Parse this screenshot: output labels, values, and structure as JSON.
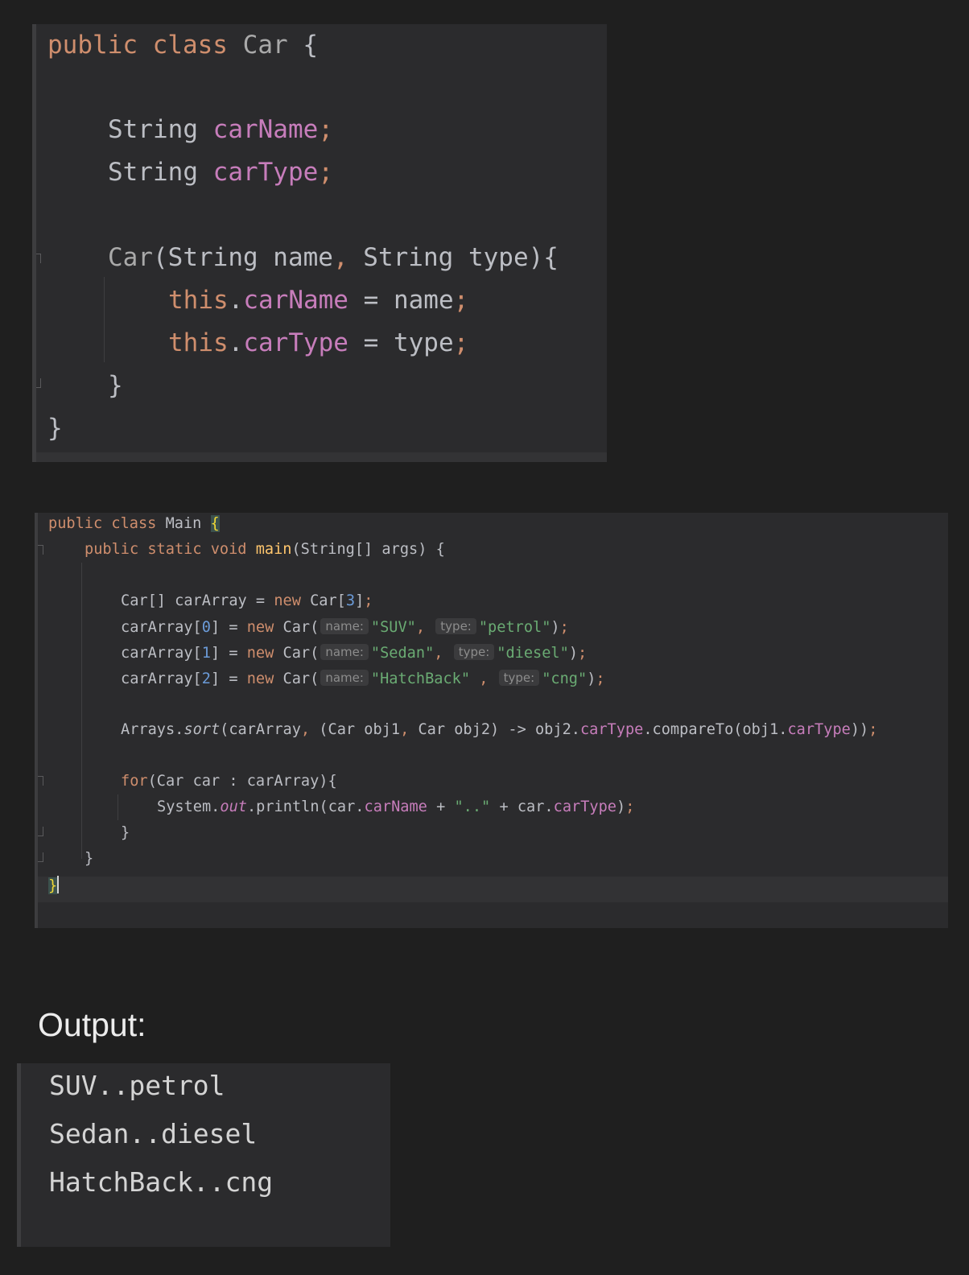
{
  "car_class_code": {
    "l1_public": "public",
    "l1_class": "class",
    "l1_name": "Car",
    "l1_brace": "{",
    "l3_type": "String",
    "l3_field": "carName",
    "l3_semi": ";",
    "l4_type": "String",
    "l4_field": "carType",
    "l4_semi": ";",
    "l6_ctor": "Car",
    "l6_p1": "(String name",
    "l6_comma": ",",
    "l6_p2": " String type){",
    "l7_this": "this",
    "l7_dot": ".",
    "l7_field": "carName",
    "l7_rest": " = name",
    "l7_semi": ";",
    "l8_this": "this",
    "l8_dot": ".",
    "l8_field": "carType",
    "l8_rest": " = type",
    "l8_semi": ";",
    "l9_close": "}",
    "l10_close": "}"
  },
  "main_class_code": {
    "l1_public": "public",
    "l1_class": "class",
    "l1_name": "Main",
    "l1_brace": "{",
    "l2_kw": "public static void",
    "l2_fn": "main",
    "l2_rest": "(String[] args) {",
    "l4_a": "Car[] carArray = ",
    "l4_new": "new",
    "l4_b": " Car[",
    "l4_num": "3",
    "l4_c": "]",
    "l4_semi": ";",
    "r1_a": "carArray[",
    "r1_idx": "0",
    "r1_b": "] = ",
    "r1_new": "new",
    "r1_c": " Car(",
    "r1_hint1": "name:",
    "r1_s1": "\"SUV\"",
    "r1_comma": ",",
    "r1_hint2": "type:",
    "r1_s2": "\"petrol\"",
    "r1_d": ")",
    "r1_semi": ";",
    "r2_a": "carArray[",
    "r2_idx": "1",
    "r2_b": "] = ",
    "r2_new": "new",
    "r2_c": " Car(",
    "r2_hint1": "name:",
    "r2_s1": "\"Sedan\"",
    "r2_comma": ",",
    "r2_hint2": "type:",
    "r2_s2": "\"diesel\"",
    "r2_d": ")",
    "r2_semi": ";",
    "r3_a": "carArray[",
    "r3_idx": "2",
    "r3_b": "] = ",
    "r3_new": "new",
    "r3_c": " Car(",
    "r3_hint1": "name:",
    "r3_s1": "\"HatchBack\"",
    "r3_comma": " ,",
    "r3_hint2": "type:",
    "r3_s2": "\"cng\"",
    "r3_d": ")",
    "r3_semi": ";",
    "sort_a": "Arrays.",
    "sort_fn": "sort",
    "sort_b": "(carArray",
    "sort_c1": ",",
    "sort_d": " (Car obj1",
    "sort_c2": ",",
    "sort_e": " Car obj2) -> obj2.",
    "sort_f1": "carType",
    "sort_g": ".compareTo(obj1.",
    "sort_f2": "carType",
    "sort_h": "))",
    "sort_semi": ";",
    "for_kw": "for",
    "for_rest": "(Car car : carArray){",
    "pr_a": "System.",
    "pr_out": "out",
    "pr_b": ".println(car.",
    "pr_f1": "carName",
    "pr_c": " + ",
    "pr_s": "\"..\"",
    "pr_d": " + car.",
    "pr_f2": "carType",
    "pr_e": ")",
    "pr_semi": ";",
    "close_for": "}",
    "close_main": "}",
    "close_class": "}"
  },
  "output_heading": "Output:",
  "output_lines": [
    "SUV..petrol",
    "Sedan..diesel",
    "HatchBack..cng"
  ]
}
